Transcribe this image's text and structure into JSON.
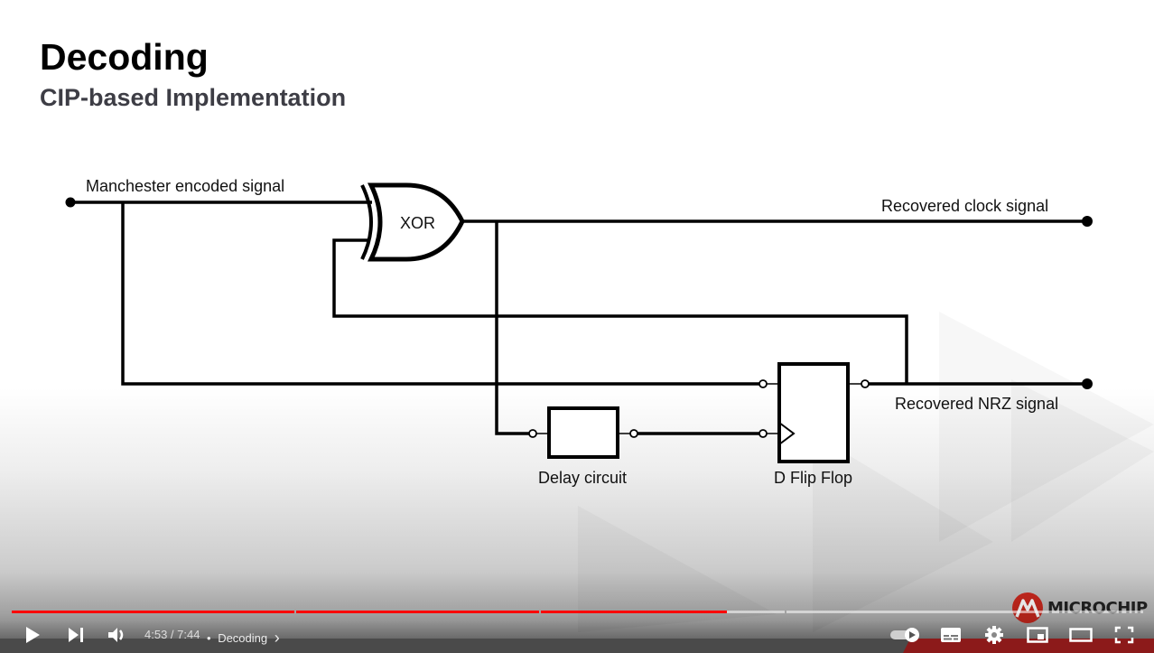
{
  "slide": {
    "title": "Decoding",
    "subtitle": "CIP-based Implementation"
  },
  "diagram": {
    "labels": {
      "input": "Manchester encoded signal",
      "xor": "XOR",
      "clock_out": "Recovered clock signal",
      "nrz_out": "Recovered NRZ signal",
      "delay": "Delay circuit",
      "flipflop": "D Flip Flop"
    }
  },
  "player": {
    "current_time": "4:53",
    "duration": "7:44",
    "time_display": "4:53 / 7:44",
    "separator": "•",
    "chapter_title": "Decoding",
    "chapter_chevron": "›",
    "progress_fraction": 0.632,
    "chapters": [
      {
        "start_fraction": 0.0,
        "end_fraction": 0.25
      },
      {
        "start_fraction": 0.25,
        "end_fraction": 0.466
      },
      {
        "start_fraction": 0.466,
        "end_fraction": 0.683
      },
      {
        "start_fraction": 0.683,
        "end_fraction": 1.0
      }
    ],
    "autoplay_on": true,
    "colors": {
      "progress": "#ff0000",
      "brand_red": "#c8281e"
    },
    "buttons": {
      "play": "play-icon",
      "next": "next-icon",
      "volume": "volume-icon",
      "autoplay": "autoplay-toggle",
      "captions": "captions-icon",
      "settings": "gear-icon",
      "miniplayer": "miniplayer-icon",
      "theater": "theater-icon",
      "fullscreen": "fullscreen-icon"
    }
  },
  "branding": {
    "logo_text": "MICROCHIP"
  }
}
